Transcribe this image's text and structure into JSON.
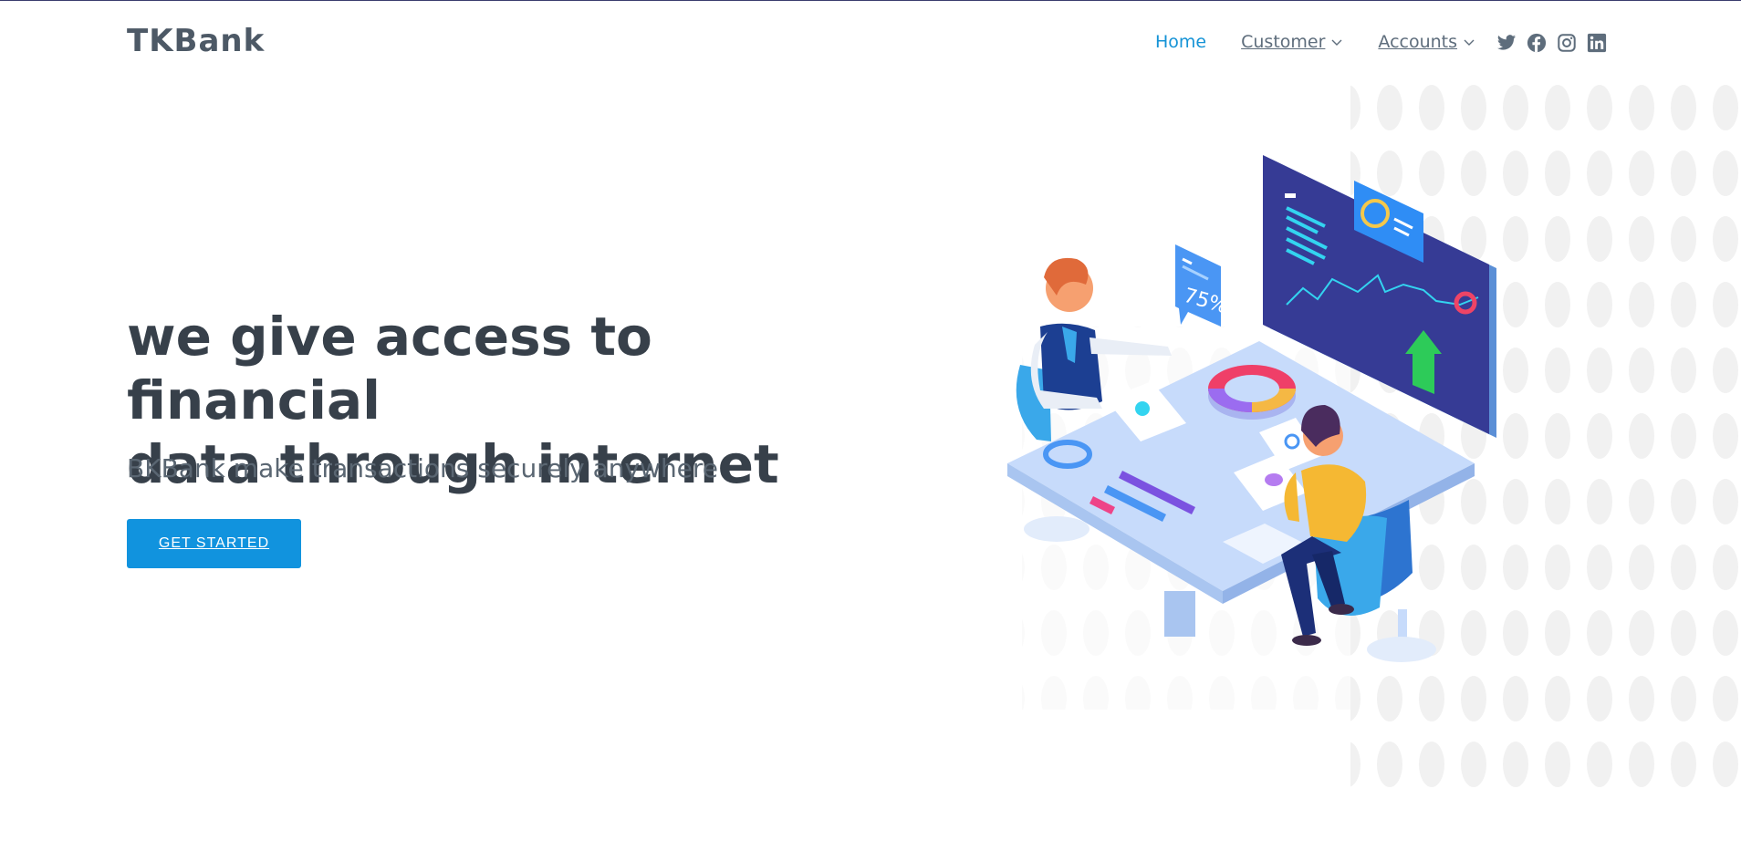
{
  "header": {
    "logo": "TKBank",
    "nav": [
      {
        "label": "Home",
        "active": true,
        "dropdown": false
      },
      {
        "label": "Customer",
        "active": false,
        "dropdown": true
      },
      {
        "label": "Accounts",
        "active": false,
        "dropdown": true
      }
    ],
    "socials": [
      "twitter-icon",
      "facebook-icon",
      "instagram-icon",
      "linkedin-icon"
    ]
  },
  "hero": {
    "headline_line1": "we give access to financial",
    "headline_line2": "data through internet",
    "subheadline": "BKBank make transactions securely anywhere",
    "cta_label": "GET STARTED",
    "illustration_text": "75%"
  },
  "colors": {
    "accent": "#1193de",
    "nav_active": "#1593d6",
    "text_dark": "#37404a",
    "text_muted": "#5a6672",
    "dashboard": "#363b95"
  }
}
